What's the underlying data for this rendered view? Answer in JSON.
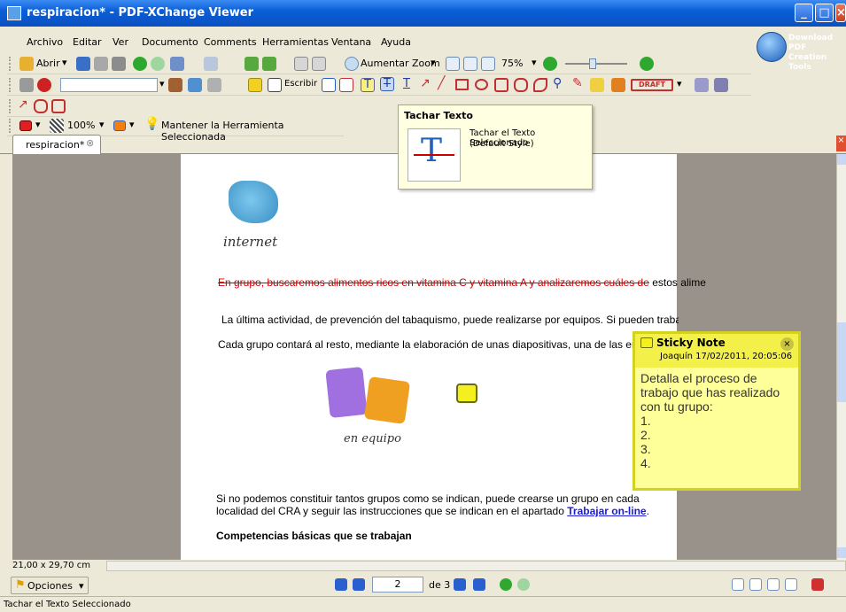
{
  "window": {
    "title": "respiracion* - PDF-XChange Viewer"
  },
  "menu": [
    "Archivo",
    "Editar",
    "Ver",
    "Documento",
    "Comments",
    "Herramientas",
    "Ventana",
    "Ayuda"
  ],
  "toolbar": {
    "open_label": "Abrir",
    "zoom_in_label": "Aumentar Zoom",
    "zoom_value": "75%",
    "write_label": "Escribir",
    "draft_label": "DRAFT",
    "opacity_value": "100%",
    "keep_tool_label": "Mantener la Herramienta Seleccionada"
  },
  "promo": {
    "line1": "Download PDF",
    "line2": "Creation Tools"
  },
  "tab": {
    "label": "respiracion*"
  },
  "tooltip": {
    "title": "Tachar Texto",
    "desc_line1": "Tachar el Texto Seleccionado",
    "desc_line2": "(Default Style)"
  },
  "document": {
    "logo_caption": "internet",
    "para1": "En grupo, buscaremos alimentos ricos en vitamina C y vitamina A y analizaremos cuáles de",
    "para1_rest": "estos alime",
    "para2": "La última actividad, de prevención del tabaquismo, puede realizarse por equipos. Si pueden trabajar co",
    "para3": "Cada grupo  contará al resto, mediante la elaboración de unas diapositivas, una de las enferm",
    "team_caption": "en equipo",
    "para4_line1": "Si no podemos constituir tantos grupos como se indican, puede crearse un grupo en cada",
    "para4_line2": "localidad del CRA y seguir las instrucciones que se indican en el apartado",
    "link": "Trabajar on-line",
    "para4_end": ".",
    "heading": "Competencias básicas que se trabajan"
  },
  "sticky": {
    "title": "Sticky Note",
    "meta": "Joaquín  17/02/2011, 20:05:06",
    "body_line1": "Detalla el proceso de",
    "body_line2": "trabajo que has realizado",
    "body_line3": "con tu grupo:",
    "items": [
      "1.",
      "2.",
      "3.",
      "4."
    ]
  },
  "page_size": "21,00 x 29,70 cm",
  "bottom": {
    "options_label": "Opciones",
    "page_current": "2",
    "page_total": "de 3"
  },
  "status": "Tachar el Texto Seleccionado",
  "colors": {
    "title_blue": "#0a5fd8",
    "sticky_yellow": "#ffff99",
    "strike_red": "#cc0000",
    "link_blue": "#1a1adb"
  }
}
